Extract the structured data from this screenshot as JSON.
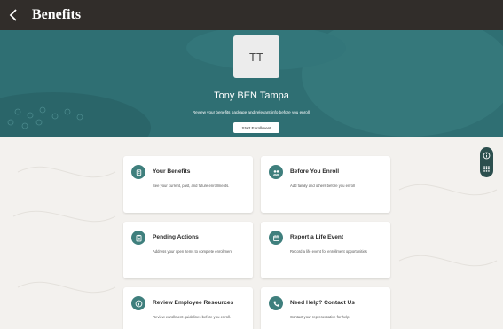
{
  "header": {
    "title": "Benefits"
  },
  "hero": {
    "initials": "TT",
    "name": "Tony BEN Tampa",
    "tagline": "Review your benefits package and relevant info before you enroll.",
    "start_label": "Start Enrollment"
  },
  "cards": [
    {
      "title": "Your Benefits",
      "description": "See your current, past, and future enrollments.",
      "icon": "benefits-icon"
    },
    {
      "title": "Before You Enroll",
      "description": "Add family and others before you enroll",
      "icon": "group-icon"
    },
    {
      "title": "Pending Actions",
      "description": "Address your open items to complete enrollment",
      "icon": "clipboard-icon"
    },
    {
      "title": "Report a Life Event",
      "description": "Record a life event for enrollment opportunities",
      "icon": "calendar-icon"
    },
    {
      "title": "Review Employee Resources",
      "description": "Review enrollment guidelines before you enroll.",
      "icon": "info-icon"
    },
    {
      "title": "Need Help? Contact Us",
      "description": "Contact your representative for help",
      "icon": "phone-icon"
    }
  ],
  "colors": {
    "topbar": "#312d2a",
    "hero": "#2f6f73",
    "accent": "#3f7f7d",
    "page": "#f3f1ee"
  }
}
